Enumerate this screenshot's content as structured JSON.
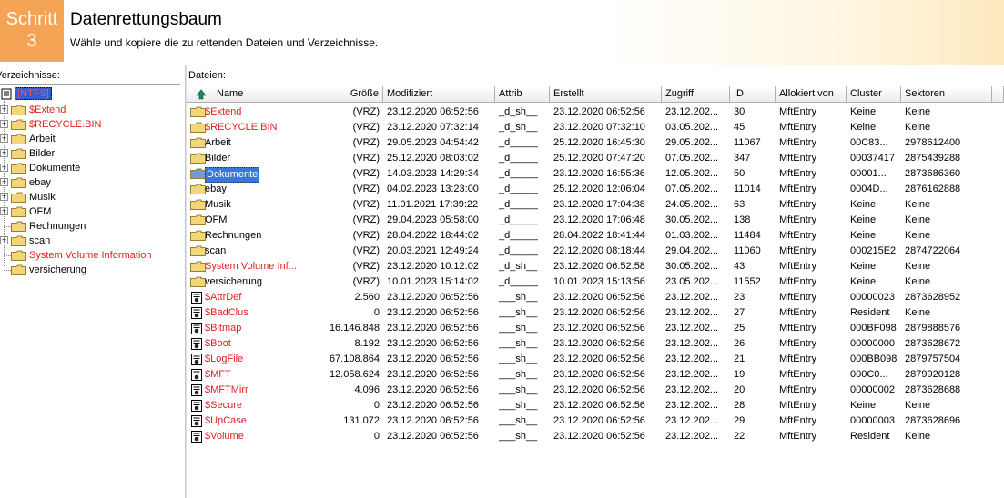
{
  "header": {
    "step_line1": "Schritt",
    "step_line2": "3",
    "title": "Datenrettungsbaum",
    "subtitle": "Wähle und kopiere die zu rettenden Dateien und Verzeichnisse."
  },
  "tree": {
    "label": "Verzeichnisse:",
    "root": "[NTFS]",
    "items": [
      {
        "label": "$Extend",
        "red": true,
        "expander": true
      },
      {
        "label": "$RECYCLE.BIN",
        "red": true,
        "expander": true
      },
      {
        "label": "Arbeit",
        "red": false,
        "expander": true
      },
      {
        "label": "Bilder",
        "red": false,
        "expander": true
      },
      {
        "label": "Dokumente",
        "red": false,
        "expander": true
      },
      {
        "label": "ebay",
        "red": false,
        "expander": true
      },
      {
        "label": "Musik",
        "red": false,
        "expander": true
      },
      {
        "label": "OFM",
        "red": false,
        "expander": true
      },
      {
        "label": "Rechnungen",
        "red": false,
        "expander": false
      },
      {
        "label": "scan",
        "red": false,
        "expander": true
      },
      {
        "label": "System Volume Information",
        "red": true,
        "expander": false
      },
      {
        "label": "versicherung",
        "red": false,
        "expander": false
      }
    ]
  },
  "files": {
    "label": "Dateien:",
    "columns": [
      "Name",
      "Größe",
      "Modifiziert",
      "Attrib",
      "Erstellt",
      "Zugriff",
      "ID",
      "Allokiert von",
      "Cluster",
      "Sektoren"
    ],
    "rows": [
      {
        "name": "$Extend",
        "size": "(VRZ)",
        "modified": "23.12.2020 06:52:56",
        "attrib": "_d_sh__",
        "created": "23.12.2020 06:52:56",
        "access": "23.12.202...",
        "id": "30",
        "alloc": "MftEntry",
        "cluster": "Keine",
        "sectors": "Keine",
        "type": "folder",
        "red": true
      },
      {
        "name": "$RECYCLE.BIN",
        "size": "(VRZ)",
        "modified": "23.12.2020 07:32:14",
        "attrib": "_d_sh__",
        "created": "23.12.2020 07:32:10",
        "access": "03.05.202...",
        "id": "45",
        "alloc": "MftEntry",
        "cluster": "Keine",
        "sectors": "Keine",
        "type": "folder",
        "red": true
      },
      {
        "name": "Arbeit",
        "size": "(VRZ)",
        "modified": "29.05.2023 04:54:42",
        "attrib": "_d_____",
        "created": "25.12.2020 16:45:30",
        "access": "29.05.202...",
        "id": "11067",
        "alloc": "MftEntry",
        "cluster": "00C83...",
        "sectors": "2978612400",
        "type": "folder",
        "red": false
      },
      {
        "name": "Bilder",
        "size": "(VRZ)",
        "modified": "25.12.2020 08:03:02",
        "attrib": "_d_____",
        "created": "25.12.2020 07:47:20",
        "access": "07.05.202...",
        "id": "347",
        "alloc": "MftEntry",
        "cluster": "00037417",
        "sectors": "2875439288",
        "type": "folder",
        "red": false
      },
      {
        "name": "Dokumente",
        "size": "(VRZ)",
        "modified": "14.03.2023 14:29:34",
        "attrib": "_d_____",
        "created": "23.12.2020 16:55:36",
        "access": "12.05.202...",
        "id": "50",
        "alloc": "MftEntry",
        "cluster": "00001...",
        "sectors": "2873686360",
        "type": "folder",
        "red": false,
        "selected": true
      },
      {
        "name": "ebay",
        "size": "(VRZ)",
        "modified": "04.02.2023 13:23:00",
        "attrib": "_d_____",
        "created": "25.12.2020 12:06:04",
        "access": "07.05.202...",
        "id": "11014",
        "alloc": "MftEntry",
        "cluster": "0004D...",
        "sectors": "2876162888",
        "type": "folder",
        "red": false
      },
      {
        "name": "Musik",
        "size": "(VRZ)",
        "modified": "11.01.2021 17:39:22",
        "attrib": "_d_____",
        "created": "23.12.2020 17:04:38",
        "access": "24.05.202...",
        "id": "63",
        "alloc": "MftEntry",
        "cluster": "Keine",
        "sectors": "Keine",
        "type": "folder",
        "red": false
      },
      {
        "name": "OFM",
        "size": "(VRZ)",
        "modified": "29.04.2023 05:58:00",
        "attrib": "_d_____",
        "created": "23.12.2020 17:06:48",
        "access": "30.05.202...",
        "id": "138",
        "alloc": "MftEntry",
        "cluster": "Keine",
        "sectors": "Keine",
        "type": "folder",
        "red": false
      },
      {
        "name": "Rechnungen",
        "size": "(VRZ)",
        "modified": "28.04.2022 18:44:02",
        "attrib": "_d_____",
        "created": "28.04.2022 18:41:44",
        "access": "01.03.202...",
        "id": "11484",
        "alloc": "MftEntry",
        "cluster": "Keine",
        "sectors": "Keine",
        "type": "folder",
        "red": false
      },
      {
        "name": "scan",
        "size": "(VRZ)",
        "modified": "20.03.2021 12:49:24",
        "attrib": "_d_____",
        "created": "22.12.2020 08:18:44",
        "access": "29.04.202...",
        "id": "11060",
        "alloc": "MftEntry",
        "cluster": "000215E2",
        "sectors": "2874722064",
        "type": "folder",
        "red": false
      },
      {
        "name": "System Volume Inf...",
        "size": "(VRZ)",
        "modified": "23.12.2020 10:12:02",
        "attrib": "_d_sh__",
        "created": "23.12.2020 06:52:58",
        "access": "30.05.202...",
        "id": "43",
        "alloc": "MftEntry",
        "cluster": "Keine",
        "sectors": "Keine",
        "type": "folder",
        "red": true
      },
      {
        "name": "versicherung",
        "size": "(VRZ)",
        "modified": "10.01.2023 15:14:02",
        "attrib": "_d_____",
        "created": "10.01.2023 15:13:56",
        "access": "23.05.202...",
        "id": "11552",
        "alloc": "MftEntry",
        "cluster": "Keine",
        "sectors": "Keine",
        "type": "folder",
        "red": false
      },
      {
        "name": "$AttrDef",
        "size": "2.560",
        "modified": "23.12.2020 06:52:56",
        "attrib": "___sh__",
        "created": "23.12.2020 06:52:56",
        "access": "23.12.202...",
        "id": "23",
        "alloc": "MftEntry",
        "cluster": "00000023",
        "sectors": "2873628952",
        "type": "sysfile",
        "red": true
      },
      {
        "name": "$BadClus",
        "size": "0",
        "modified": "23.12.2020 06:52:56",
        "attrib": "___sh__",
        "created": "23.12.2020 06:52:56",
        "access": "23.12.202...",
        "id": "27",
        "alloc": "MftEntry",
        "cluster": "Resident",
        "sectors": "Keine",
        "type": "sysfile",
        "red": true
      },
      {
        "name": "$Bitmap",
        "size": "16.146.848",
        "modified": "23.12.2020 06:52:56",
        "attrib": "___sh__",
        "created": "23.12.2020 06:52:56",
        "access": "23.12.202...",
        "id": "25",
        "alloc": "MftEntry",
        "cluster": "000BF098",
        "sectors": "2879888576",
        "type": "sysfile",
        "red": true
      },
      {
        "name": "$Boot",
        "size": "8.192",
        "modified": "23.12.2020 06:52:56",
        "attrib": "___sh__",
        "created": "23.12.2020 06:52:56",
        "access": "23.12.202...",
        "id": "26",
        "alloc": "MftEntry",
        "cluster": "00000000",
        "sectors": "2873628672",
        "type": "sysfile",
        "red": true
      },
      {
        "name": "$LogFile",
        "size": "67.108.864",
        "modified": "23.12.2020 06:52:56",
        "attrib": "___sh__",
        "created": "23.12.2020 06:52:56",
        "access": "23.12.202...",
        "id": "21",
        "alloc": "MftEntry",
        "cluster": "000BB098",
        "sectors": "2879757504",
        "type": "sysfile",
        "red": true
      },
      {
        "name": "$MFT",
        "size": "12.058.624",
        "modified": "23.12.2020 06:52:56",
        "attrib": "___sh__",
        "created": "23.12.2020 06:52:56",
        "access": "23.12.202...",
        "id": "19",
        "alloc": "MftEntry",
        "cluster": "000C0...",
        "sectors": "2879920128",
        "type": "sysfile",
        "red": true
      },
      {
        "name": "$MFTMirr",
        "size": "4.096",
        "modified": "23.12.2020 06:52:56",
        "attrib": "___sh__",
        "created": "23.12.2020 06:52:56",
        "access": "23.12.202...",
        "id": "20",
        "alloc": "MftEntry",
        "cluster": "00000002",
        "sectors": "2873628688",
        "type": "sysfile",
        "red": true
      },
      {
        "name": "$Secure",
        "size": "0",
        "modified": "23.12.2020 06:52:56",
        "attrib": "___sh__",
        "created": "23.12.2020 06:52:56",
        "access": "23.12.202...",
        "id": "28",
        "alloc": "MftEntry",
        "cluster": "Keine",
        "sectors": "Keine",
        "type": "sysfile",
        "red": true
      },
      {
        "name": "$UpCase",
        "size": "131.072",
        "modified": "23.12.2020 06:52:56",
        "attrib": "___sh__",
        "created": "23.12.2020 06:52:56",
        "access": "23.12.202...",
        "id": "29",
        "alloc": "MftEntry",
        "cluster": "00000003",
        "sectors": "2873628696",
        "type": "sysfile",
        "red": true
      },
      {
        "name": "$Volume",
        "size": "0",
        "modified": "23.12.2020 06:52:56",
        "attrib": "___sh__",
        "created": "23.12.2020 06:52:56",
        "access": "23.12.202...",
        "id": "22",
        "alloc": "MftEntry",
        "cluster": "Resident",
        "sectors": "Keine",
        "type": "sysfile",
        "red": true
      }
    ]
  },
  "colors": {
    "step_bg": "#f5a455",
    "deleted_red": "#e02020",
    "selection": "#3a78d8",
    "folder": "#f2d77a"
  }
}
